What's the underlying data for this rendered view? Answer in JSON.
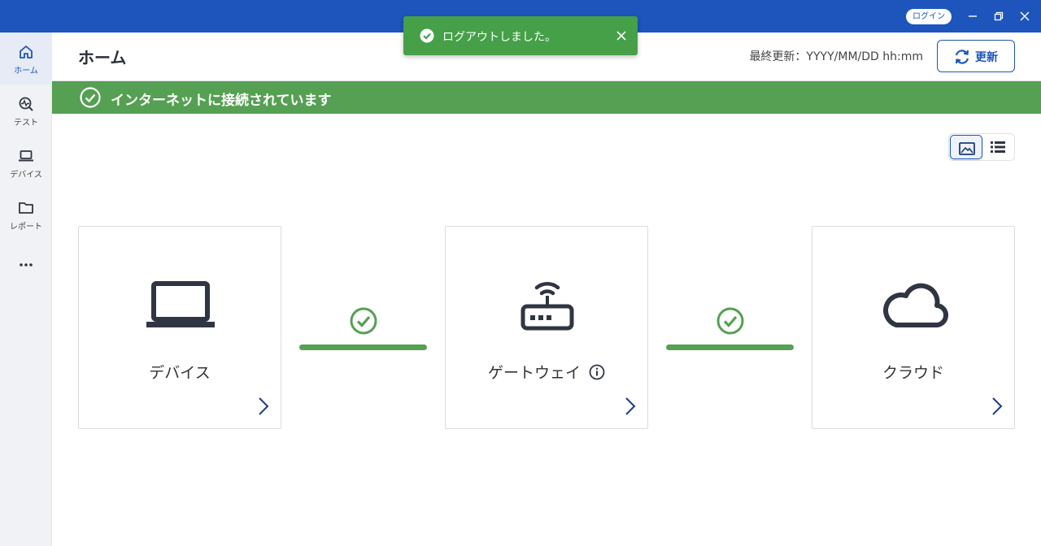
{
  "titlebar": {
    "login_label": "ログイン",
    "accent": "#1d55bd"
  },
  "sidebar": {
    "items": [
      {
        "label": "ホーム",
        "icon": "home-icon",
        "active": true
      },
      {
        "label": "テスト",
        "icon": "test-icon"
      },
      {
        "label": "デバイス",
        "icon": "laptop-icon"
      },
      {
        "label": "レポート",
        "icon": "folder-icon"
      }
    ],
    "more_icon": "more-icon"
  },
  "header": {
    "title": "ホーム",
    "last_updated": "最終更新：YYYY/MM/DD hh:mm",
    "refresh_label": "更新"
  },
  "banner": {
    "text": "インターネットに接続されています",
    "color": "#55a052"
  },
  "view_toggle": {
    "options": [
      "image-view-icon",
      "list-view-icon"
    ],
    "selected": "image-view-icon"
  },
  "cards": [
    {
      "label": "デバイス",
      "icon": "laptop-icon"
    },
    {
      "label": "ゲートウェイ",
      "icon": "router-icon",
      "info": true
    },
    {
      "label": "クラウド",
      "icon": "cloud-icon"
    }
  ],
  "connections": [
    {
      "status": "ok"
    },
    {
      "status": "ok"
    }
  ],
  "toast": {
    "message": "ログアウトしました。",
    "color": "#45a048"
  }
}
